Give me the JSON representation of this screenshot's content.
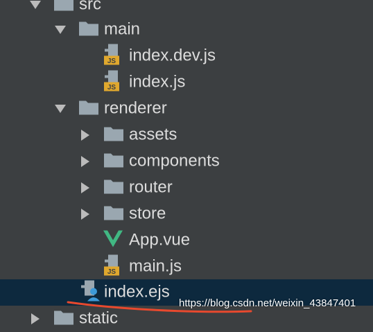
{
  "tree": {
    "items": [
      {
        "label": "src",
        "type": "folder",
        "expanded": true,
        "level": 0
      },
      {
        "label": "main",
        "type": "folder",
        "expanded": true,
        "level": 1
      },
      {
        "label": "index.dev.js",
        "type": "js-file",
        "level": 2
      },
      {
        "label": "index.js",
        "type": "js-file",
        "level": 2
      },
      {
        "label": "renderer",
        "type": "folder",
        "expanded": true,
        "level": 1
      },
      {
        "label": "assets",
        "type": "folder",
        "expanded": false,
        "level": 2
      },
      {
        "label": "components",
        "type": "folder",
        "expanded": false,
        "level": 2
      },
      {
        "label": "router",
        "type": "folder",
        "expanded": false,
        "level": 2
      },
      {
        "label": "store",
        "type": "folder",
        "expanded": false,
        "level": 2
      },
      {
        "label": "App.vue",
        "type": "vue-file",
        "level": 2
      },
      {
        "label": "main.js",
        "type": "js-file",
        "level": 2
      },
      {
        "label": "index.ejs",
        "type": "ejs-file",
        "level": 1,
        "selected": true
      },
      {
        "label": "static",
        "type": "folder",
        "expanded": false,
        "level": 0
      }
    ],
    "js_badge": "JS"
  },
  "watermark": "https://blog.csdn.net/weixin_43847401",
  "colors": {
    "background": "#3c3f41",
    "selection": "#0d293e",
    "folder": "#9aa7b0",
    "text": "#dcdcdc",
    "js_badge": "#e0a82e",
    "vue_green": "#41b883",
    "underline": "#e8492e"
  }
}
